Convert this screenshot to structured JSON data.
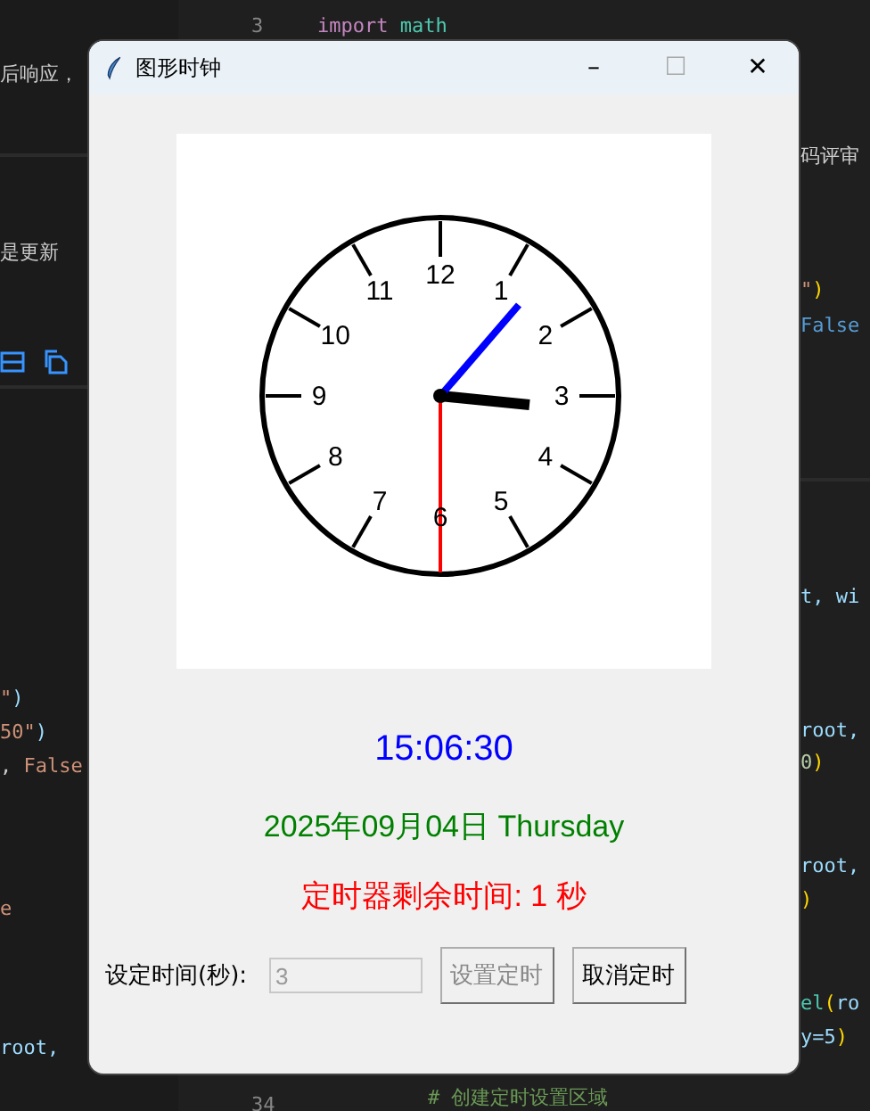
{
  "editor_background": {
    "fragments": [
      {
        "tokens": [
          {
            "text": "后响应，",
            "color": "#cccccc"
          }
        ]
      },
      {
        "tokens": [
          {
            "text": "3",
            "color": "#858585"
          }
        ]
      },
      {
        "tokens": [
          {
            "text": "import",
            "color": "#c586c0"
          },
          {
            "text": " math",
            "color": "#4ec9b0"
          }
        ]
      },
      {
        "tokens": [
          {
            "text": "码评审",
            "color": "#cccccc"
          }
        ]
      },
      {
        "tokens": [
          {
            "text": "是更新",
            "color": "#cccccc"
          }
        ]
      },
      {
        "tokens": [
          {
            "text": "\"",
            "color": "#ce9178"
          },
          {
            "text": ")",
            "color": "#ffd700"
          }
        ]
      },
      {
        "tokens": [
          {
            "text": "False",
            "color": "#569cd6"
          }
        ]
      },
      {
        "tokens": [
          {
            "text": "\"",
            "color": "#ce9178"
          },
          {
            "text": ")",
            "color": "#9cdcfe"
          }
        ]
      },
      {
        "tokens": [
          {
            "text": "50\"",
            "color": "#ce9178"
          },
          {
            "text": ")",
            "color": "#9cdcfe"
          }
        ]
      },
      {
        "tokens": [
          {
            "text": ", ",
            "color": "#cccccc"
          },
          {
            "text": "False",
            "color": "#ce9178"
          }
        ]
      },
      {
        "tokens": [
          {
            "text": "t, wi",
            "color": "#9cdcfe"
          }
        ]
      },
      {
        "tokens": [
          {
            "text": "root,",
            "color": "#9cdcfe"
          }
        ]
      },
      {
        "tokens": [
          {
            "text": "0",
            "color": "#b5cea8"
          },
          {
            "text": ")",
            "color": "#ffd700"
          }
        ]
      },
      {
        "tokens": [
          {
            "text": "root,",
            "color": "#9cdcfe"
          }
        ]
      },
      {
        "tokens": [
          {
            "text": ")",
            "color": "#ffd700"
          }
        ]
      },
      {
        "tokens": [
          {
            "text": "e",
            "color": "#ce9178"
          }
        ]
      },
      {
        "tokens": [
          {
            "text": "el",
            "color": "#4ec9b0"
          },
          {
            "text": "(",
            "color": "#ffd700"
          },
          {
            "text": "ro",
            "color": "#9cdcfe"
          }
        ]
      },
      {
        "tokens": [
          {
            "text": "y=5",
            "color": "#9cdcfe"
          },
          {
            "text": ")",
            "color": "#ffd700"
          }
        ]
      },
      {
        "tokens": [
          {
            "text": "root,",
            "color": "#9cdcfe"
          }
        ]
      },
      {
        "tokens": [
          {
            "text": "34",
            "color": "#858585"
          }
        ]
      },
      {
        "tokens": [
          {
            "text": "# 创建定时设置区域",
            "color": "#6a9955"
          }
        ]
      }
    ]
  },
  "window": {
    "title": "图形时钟",
    "controls": [
      "–",
      "☐",
      "✕"
    ]
  },
  "clock": {
    "dial_numbers": [
      "12",
      "1",
      "2",
      "3",
      "4",
      "5",
      "6",
      "7",
      "8",
      "9",
      "10",
      "11"
    ]
  },
  "time_label": "15:06:30",
  "date_label": "2025年09月04日 Thursday",
  "timer_label": "定时器剩余时间: 1 秒",
  "timer_setting": {
    "label": "设定时间(秒):",
    "input": {
      "value": "3",
      "disabled": true
    },
    "buttons": [
      {
        "label": "设置定时",
        "disabled": true
      },
      {
        "label": "取消定时",
        "disabled": false
      }
    ]
  }
}
